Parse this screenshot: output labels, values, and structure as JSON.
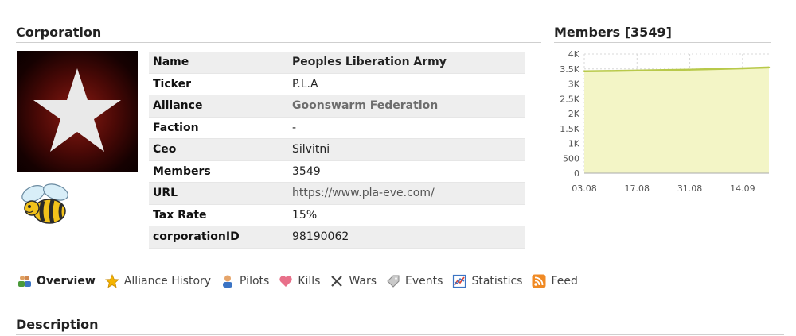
{
  "headings": {
    "corporation": "Corporation",
    "members": "Members [3549]",
    "description": "Description"
  },
  "info": {
    "rows": [
      {
        "key": "Name",
        "value": "Peoples Liberation Army"
      },
      {
        "key": "Ticker",
        "value": "P.L.A"
      },
      {
        "key": "Alliance",
        "value": "Goonswarm Federation"
      },
      {
        "key": "Faction",
        "value": "-"
      },
      {
        "key": "Ceo",
        "value": "Silvitni"
      },
      {
        "key": "Members",
        "value": "3549"
      },
      {
        "key": "URL",
        "value": "https://www.pla-eve.com/"
      },
      {
        "key": "Tax Rate",
        "value": "15%"
      },
      {
        "key": "corporationID",
        "value": "98190062"
      }
    ]
  },
  "chart_data": {
    "type": "area",
    "title": "Members [3549]",
    "x_tick_labels": [
      "03.08",
      "17.08",
      "31.08",
      "14.09"
    ],
    "y_tick_labels": [
      "0",
      "500",
      "1K",
      "1.5K",
      "2K",
      "2.5K",
      "3K",
      "3.5K",
      "4K"
    ],
    "ylim": [
      0,
      4000
    ],
    "grid": true,
    "series": [
      {
        "x": [
          "03.08",
          "10.08",
          "17.08",
          "24.08",
          "31.08",
          "07.09",
          "14.09",
          "21.09"
        ],
        "values": [
          3420,
          3430,
          3445,
          3460,
          3475,
          3495,
          3520,
          3549
        ]
      }
    ],
    "colors": {
      "line": "#b8c94a",
      "fill": "#f3f5c6",
      "grid": "#d8d8d8",
      "axis_text": "#555555"
    }
  },
  "nav": {
    "items": [
      {
        "label": "Overview",
        "icon": "people-icon"
      },
      {
        "label": "Alliance History",
        "icon": "star-icon"
      },
      {
        "label": "Pilots",
        "icon": "pilot-icon"
      },
      {
        "label": "Kills",
        "icon": "heart-icon"
      },
      {
        "label": "Wars",
        "icon": "crossed-swords-icon"
      },
      {
        "label": "Events",
        "icon": "tag-icon"
      },
      {
        "label": "Statistics",
        "icon": "statistics-icon"
      },
      {
        "label": "Feed",
        "icon": "rss-icon"
      }
    ]
  }
}
